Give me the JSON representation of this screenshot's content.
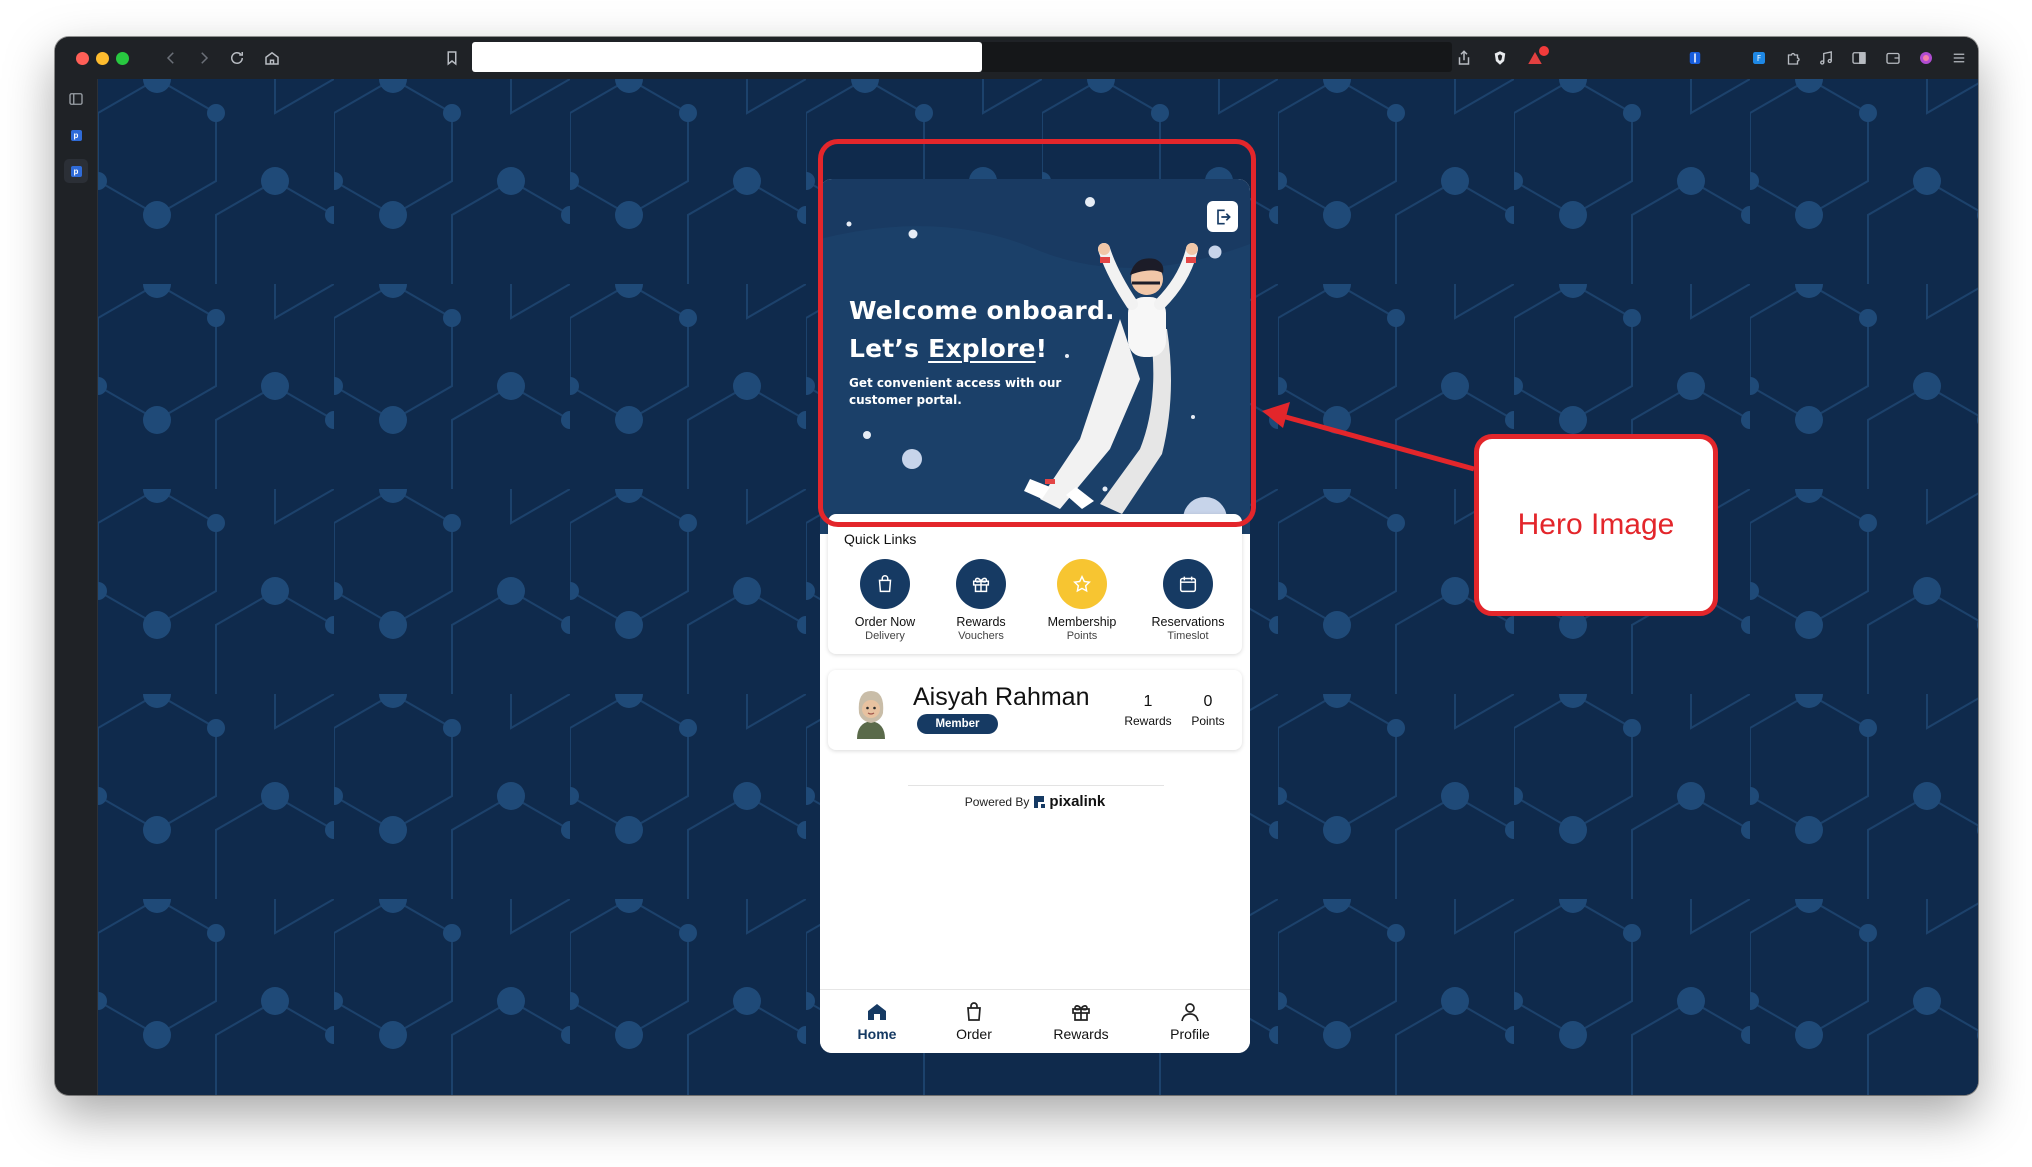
{
  "browser": {
    "icons": [
      "sidebar-toggle-icon",
      "back-icon",
      "forward-icon",
      "reload-icon",
      "home-icon",
      "bookmark-icon",
      "share-icon",
      "brave-shield-icon",
      "brave-rewards-icon",
      "bitwarden-icon",
      "extension-icon",
      "puzzle-icon",
      "music-icon",
      "sidebar-icon",
      "wallet-icon",
      "profile-icon",
      "menu-icon"
    ],
    "new_tab": "+"
  },
  "hero": {
    "title_line1": "Welcome onboard.",
    "title_line2_prefix": "Let’s ",
    "title_line2_emph": "Explore",
    "title_line2_suffix": "!",
    "subtitle": "Get convenient access with our customer portal."
  },
  "quick_links": {
    "title": "Quick Links",
    "items": [
      {
        "label": "Order Now",
        "sub": "Delivery",
        "icon": "bag-icon"
      },
      {
        "label": "Rewards",
        "sub": "Vouchers",
        "icon": "gift-icon"
      },
      {
        "label": "Membership",
        "sub": "Points",
        "icon": "star-icon"
      },
      {
        "label": "Reservations",
        "sub": "Timeslot",
        "icon": "calendar-icon"
      }
    ]
  },
  "member": {
    "name": "Aisyah Rahman",
    "tier": "Member",
    "rewards_value": "1",
    "rewards_label": "Rewards",
    "points_value": "0",
    "points_label": "Points"
  },
  "footer": {
    "powered_by": "Powered By",
    "brand": "pixalink"
  },
  "bottom_nav": [
    {
      "label": "Home",
      "icon": "home-icon",
      "active": true
    },
    {
      "label": "Order",
      "icon": "bag-icon"
    },
    {
      "label": "Rewards",
      "icon": "gift-icon"
    },
    {
      "label": "Profile",
      "icon": "user-icon"
    }
  ],
  "annotation": {
    "label": "Hero Image"
  },
  "colors": {
    "brand_navy": "#163a63",
    "hero_bg": "#193a62",
    "gold": "#f7c531",
    "annotation_red": "#e3262b",
    "page_bg": "#0f2a4c"
  }
}
